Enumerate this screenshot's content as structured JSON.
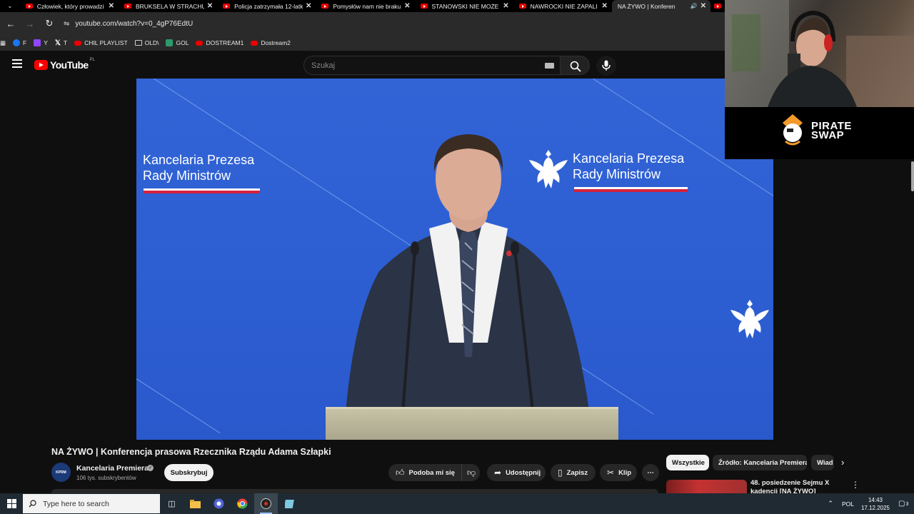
{
  "browser": {
    "tabs": [
      {
        "title": "Człowiek, który prowadzi",
        "active": false
      },
      {
        "title": "BRUKSELA W STRACHU. W",
        "active": false
      },
      {
        "title": "Policja zatrzymała 12-latk",
        "active": false
      },
      {
        "title": "Pomysłów nam nie braku",
        "active": false
      },
      {
        "title": "STANOWSKI NIE MOŻE U",
        "active": false
      },
      {
        "title": "NAWROCKI NIE ZAPALI C",
        "active": false
      },
      {
        "title": "NA ŻYWO | Konferen",
        "active": true
      }
    ],
    "url": "youtube.com/watch?v=0_4gP76EdtU",
    "bookmarks": [
      {
        "label": "F",
        "icon": "facebook-icon"
      },
      {
        "label": "Y",
        "icon": "twitch-icon"
      },
      {
        "label": "T",
        "icon": "x-icon"
      },
      {
        "label": "CHIL PLAYLIST",
        "icon": "youtube-icon"
      },
      {
        "label": "OLD\\",
        "icon": "folder-icon"
      },
      {
        "label": "GOL",
        "icon": "gol-icon"
      },
      {
        "label": "DOSTREAM1",
        "icon": "youtube-icon"
      },
      {
        "label": "Dostream2",
        "icon": "youtube-icon"
      }
    ]
  },
  "youtube": {
    "logo_text": "YouTube",
    "country_code": "PL",
    "search_placeholder": "Szukaj"
  },
  "video": {
    "overlay_text_left": [
      "Kancelaria Prezesa",
      "Rady Ministrów"
    ],
    "overlay_text_right": [
      "Kancelaria Prezesa",
      "Rady Ministrów"
    ],
    "title": "NA ŻYWO | Konferencja prasowa Rzecznika Rządu Adama Szłapki",
    "channel": {
      "name": "Kancelaria Premiera",
      "avatar_text": "KPRM",
      "subscribers": "106 tys. subskrybentów",
      "subscribe_label": "Subskrybuj"
    },
    "actions": {
      "like": "Podoba mi się",
      "share": "Udostępnij",
      "save": "Zapisz",
      "clip": "Klip"
    }
  },
  "chips": [
    "Wszystkie",
    "Źródło: Kancelaria Premiera",
    "Wiad"
  ],
  "recommendation": {
    "title": "48. posiedzenie Sejmu X kadencji [NA ŻYWO]"
  },
  "sponsor": {
    "line1": "PIRATE",
    "line2": "SWAP"
  },
  "taskbar": {
    "search_placeholder": "Type here to search",
    "language": "POL",
    "time": "14:43",
    "date": "17.12.2025",
    "notifications": "3"
  },
  "colors": {
    "video_background": "#2d5fd3",
    "youtube_red": "#ff0000",
    "flag_red": "#d4213d"
  }
}
